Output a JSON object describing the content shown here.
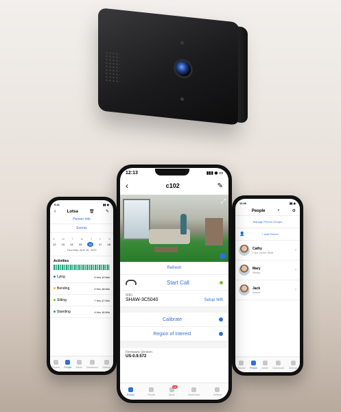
{
  "colors": {
    "accent": "#2f6fd6",
    "status_green": "#7bbf2a",
    "alert_red": "#e04a4a"
  },
  "center": {
    "status_time": "12:13",
    "title": "c102",
    "refresh": "Refresh",
    "start_call": "Start Call",
    "wifi_label": "WiFi",
    "wifi_name": "SHAW-3C5040",
    "setup_wifi": "Setup Wifi",
    "calibrate": "Calibrate",
    "region": "Region of Interest",
    "firmware_label": "Firmware Version",
    "firmware_value": "US-0.9.572",
    "tabs": [
      "Rooms",
      "People",
      "Alerts",
      "Dashboard",
      "Settings"
    ],
    "alerts_badge": "10"
  },
  "left": {
    "title": "Lotsa",
    "link1": "Person Info",
    "link2": "Events",
    "days": [
      "S",
      "M",
      "T",
      "W",
      "T",
      "F",
      "S"
    ],
    "dates": [
      "12",
      "13",
      "14",
      "15",
      "16",
      "17",
      "18"
    ],
    "date_caption": "Thursday, April 16, 2020",
    "activities": "Activities",
    "rows": [
      {
        "label": "Lying",
        "value": "0 Hrs 10 Min"
      },
      {
        "label": "Bending",
        "value": "0 Hrs 18 Min"
      },
      {
        "label": "Sitting",
        "value": "7 Hrs 47 Min"
      },
      {
        "label": "Standing",
        "value": "4 Hrs 18 Min"
      }
    ],
    "row_colors": [
      "#2f6fd6",
      "#f2b705",
      "#7bbf2a",
      "#1aa77a"
    ],
    "tabs": [
      "Rooms",
      "People",
      "Alerts",
      "Dashboard",
      "Settings"
    ]
  },
  "right": {
    "title": "People",
    "manage": "Manage Person Groups",
    "add": "+ Add Person",
    "people": [
      {
        "name": "Cathy",
        "role": "Care Home Staff"
      },
      {
        "name": "Mary",
        "role": "Senior"
      },
      {
        "name": "Jack",
        "role": "Senior"
      }
    ],
    "tabs": [
      "Rooms",
      "People",
      "Alerts",
      "Dashboard",
      "Settings"
    ]
  }
}
